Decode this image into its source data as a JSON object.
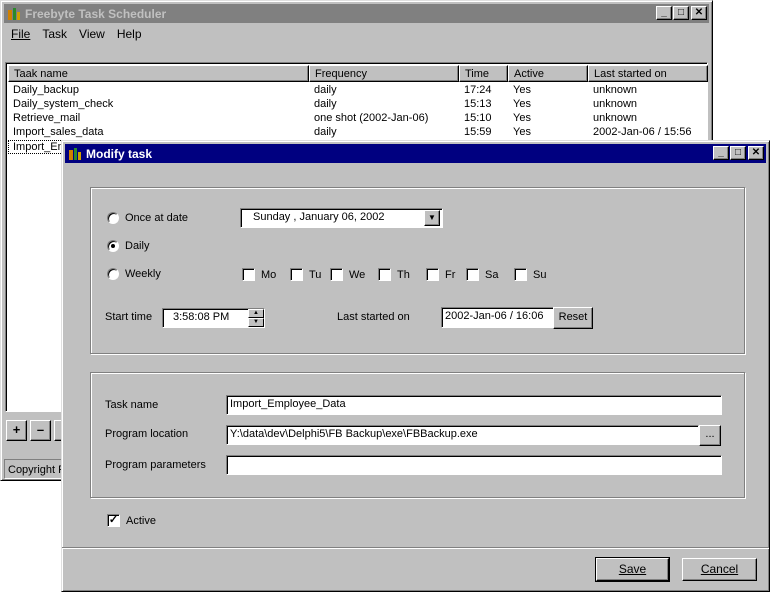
{
  "main_window": {
    "title": "Freebyte Task Scheduler",
    "menu": [
      "File",
      "Task",
      "View",
      "Help"
    ],
    "columns": [
      "Taak name",
      "Frequency",
      "Time",
      "Active",
      "Last started on"
    ],
    "rows": [
      [
        "Daily_backup",
        "daily",
        "17:24",
        "Yes",
        "unknown"
      ],
      [
        "Daily_system_check",
        "daily",
        "15:13",
        "Yes",
        "unknown"
      ],
      [
        "Retrieve_mail",
        "one shot (2002-Jan-06)",
        "15:10",
        "Yes",
        "unknown"
      ],
      [
        "Import_sales_data",
        "daily",
        "15:59",
        "Yes",
        "2002-Jan-06 / 15:56"
      ],
      [
        "Import_Em",
        "",
        "",
        "",
        ""
      ]
    ],
    "buttons": {
      "add": "+",
      "remove": "–",
      "edit": "-"
    },
    "status": "Copyright Fr"
  },
  "dialog": {
    "title": "Modify task",
    "schedule": {
      "once_label": "Once at date",
      "date_value": "Sunday   ,  January   06, 2002",
      "daily_label": "Daily",
      "weekly_label": "Weekly",
      "selected": "daily",
      "days": [
        "Mo",
        "Tu",
        "We",
        "Th",
        "Fr",
        "Sa",
        "Su"
      ],
      "start_time_label": "Start time",
      "start_time_value": "3:58:08 PM",
      "last_started_label": "Last started on",
      "last_started_value": "2002-Jan-06 / 16:06",
      "reset_label": "Reset"
    },
    "task": {
      "name_label": "Task name",
      "name_value": "Import_Employee_Data",
      "location_label": "Program location",
      "location_value": "Y:\\data\\dev\\Delphi5\\FB Backup\\exe\\FBBackup.exe",
      "browse_label": "...",
      "params_label": "Program parameters",
      "params_value": ""
    },
    "active_label": "Active",
    "active_checked": true,
    "save_label": "Save",
    "cancel_label": "Cancel"
  }
}
